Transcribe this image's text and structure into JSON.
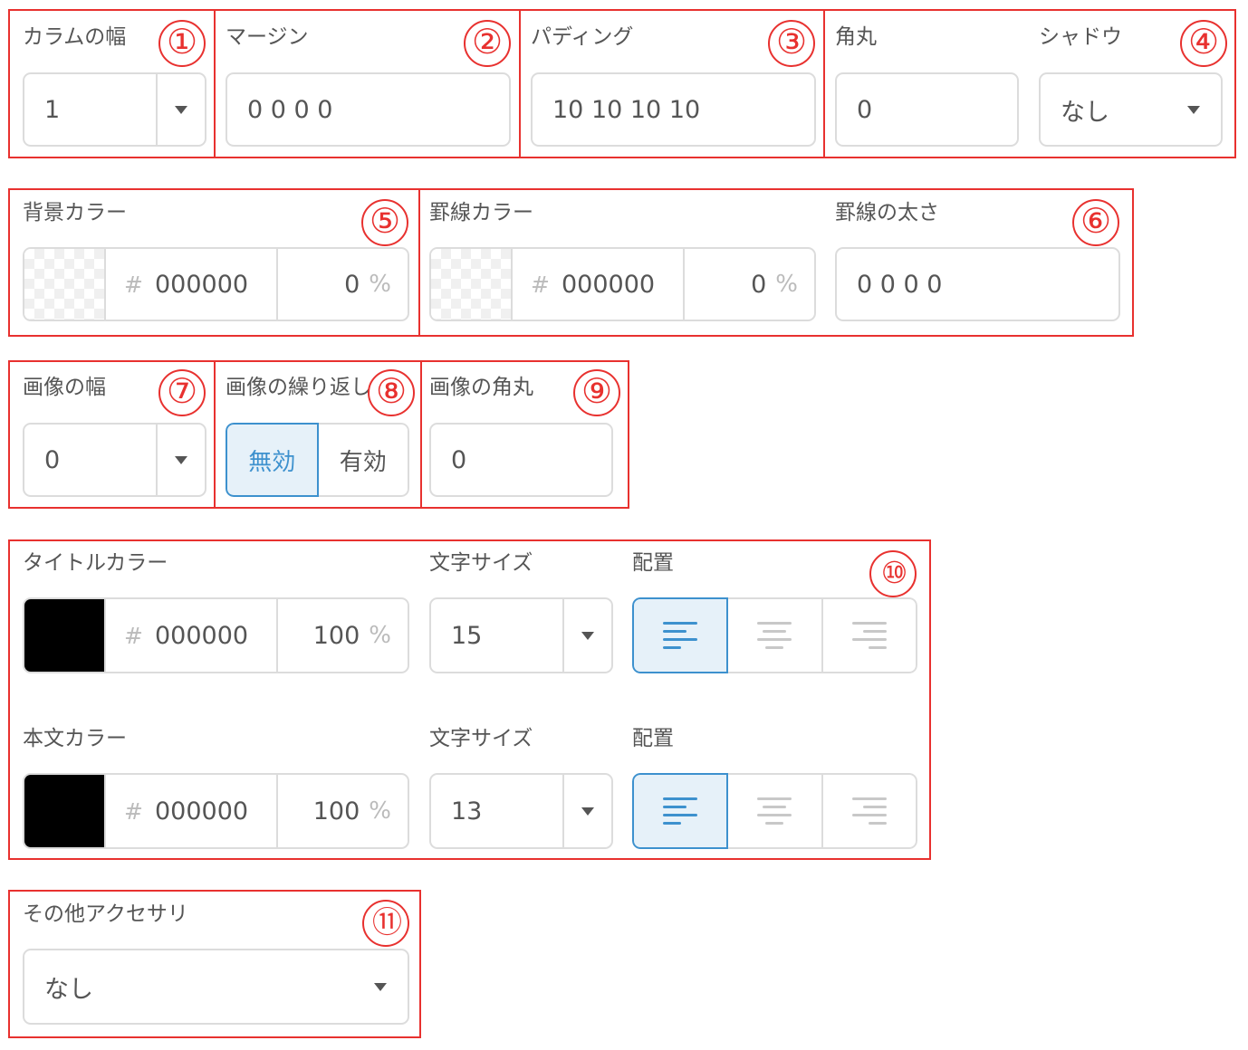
{
  "markers": [
    "①",
    "②",
    "③",
    "④",
    "⑤",
    "⑥",
    "⑦",
    "⑧",
    "⑨",
    "⑩",
    "⑪"
  ],
  "column": {
    "label": "カラムの幅",
    "value": "1"
  },
  "margin": {
    "label": "マージン",
    "value": "0 0 0 0"
  },
  "padding": {
    "label": "パディング",
    "value": "10 10 10 10"
  },
  "radius": {
    "label": "角丸",
    "value": "0"
  },
  "shadow": {
    "label": "シャドウ",
    "value": "なし"
  },
  "bg_color": {
    "label": "背景カラー",
    "hash": "#",
    "hex": "000000",
    "opacity": "0",
    "pct": "%"
  },
  "border_color": {
    "label": "罫線カラー",
    "hash": "#",
    "hex": "000000",
    "opacity": "0",
    "pct": "%"
  },
  "border_width": {
    "label": "罫線の太さ",
    "value": "0 0 0 0"
  },
  "image_width": {
    "label": "画像の幅",
    "value": "0"
  },
  "image_repeat": {
    "label": "画像の繰り返し",
    "options": [
      "無効",
      "有効"
    ],
    "selected": "無効"
  },
  "image_radius": {
    "label": "画像の角丸",
    "value": "0"
  },
  "title_text": {
    "color_label": "タイトルカラー",
    "hash": "#",
    "hex": "000000",
    "opacity": "100",
    "pct": "%",
    "swatch": "#000000",
    "size_label": "文字サイズ",
    "size": "15",
    "align_label": "配置",
    "align_selected": "left"
  },
  "body_text": {
    "color_label": "本文カラー",
    "hash": "#",
    "hex": "000000",
    "opacity": "100",
    "pct": "%",
    "swatch": "#000000",
    "size_label": "文字サイズ",
    "size": "13",
    "align_label": "配置",
    "align_selected": "left"
  },
  "accessory": {
    "label": "その他アクセサリ",
    "value": "なし"
  },
  "colors": {
    "annotation": "#e8312f",
    "accent": "#3d91ce",
    "accent_bg": "#e6f1f9",
    "border": "#dcdcdc"
  }
}
